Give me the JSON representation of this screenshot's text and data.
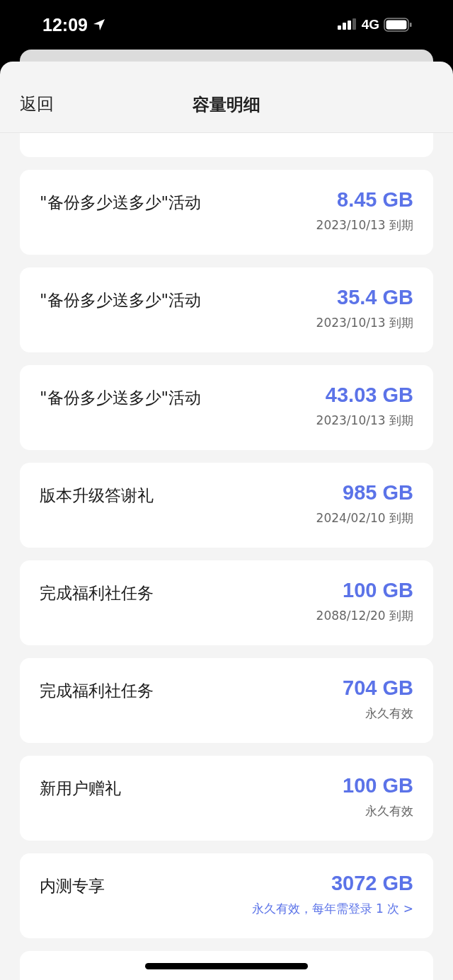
{
  "status_bar": {
    "time": "12:09",
    "network": "4G"
  },
  "header": {
    "back": "返回",
    "title": "容量明细"
  },
  "items": [
    {
      "title": "\"备份多少送多少\"活动",
      "amount": "8.45 GB",
      "kind": "date",
      "note": "2023/10/13 到期"
    },
    {
      "title": "\"备份多少送多少\"活动",
      "amount": "35.4 GB",
      "kind": "date",
      "note": "2023/10/13 到期"
    },
    {
      "title": "\"备份多少送多少\"活动",
      "amount": "43.03 GB",
      "kind": "date",
      "note": "2023/10/13 到期"
    },
    {
      "title": "版本升级答谢礼",
      "amount": "985 GB",
      "kind": "date",
      "note": "2024/02/10 到期"
    },
    {
      "title": "完成福利社任务",
      "amount": "100 GB",
      "kind": "date",
      "note": "2088/12/20 到期"
    },
    {
      "title": "完成福利社任务",
      "amount": "704 GB",
      "kind": "date",
      "note": "永久有效"
    },
    {
      "title": "新用户赠礼",
      "amount": "100 GB",
      "kind": "date",
      "note": "永久有效"
    },
    {
      "title": "内测专享",
      "amount": "3072 GB",
      "kind": "link",
      "note": "永久有效，每年需登录 1 次 >"
    }
  ]
}
